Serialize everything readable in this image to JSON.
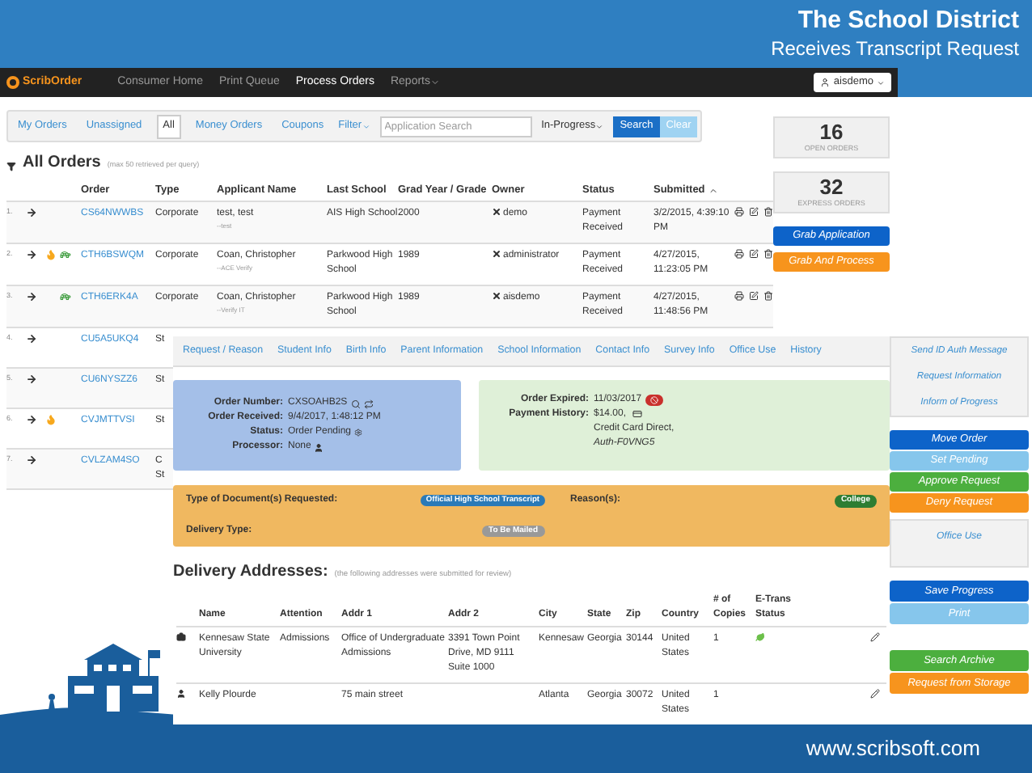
{
  "slide": {
    "title": "The School District",
    "subtitle": "Receives Transcript Request",
    "website": "www.scribsoft.com"
  },
  "navbar": {
    "logo": "ScribOrder",
    "items": [
      {
        "label": "Consumer Home",
        "selected": false,
        "dropdown": false
      },
      {
        "label": "Print Queue",
        "selected": false,
        "dropdown": false
      },
      {
        "label": "Process Orders",
        "selected": true,
        "dropdown": false
      },
      {
        "label": "Reports",
        "selected": false,
        "dropdown": true
      }
    ],
    "user": "aisdemo"
  },
  "filter_tabs": [
    {
      "label": "My Orders",
      "selected": false
    },
    {
      "label": "Unassigned",
      "selected": false
    },
    {
      "label": "All",
      "selected": true
    },
    {
      "label": "Money Orders",
      "selected": false
    },
    {
      "label": "Coupons",
      "selected": false
    }
  ],
  "filter_menu": "Filter",
  "search": {
    "placeholder": "Application Search"
  },
  "status_select": "In-Progress",
  "search_button": "Search",
  "clear_button": "Clear",
  "counters": [
    {
      "value": "16",
      "label": "OPEN ORDERS"
    },
    {
      "value": "32",
      "label": "EXPRESS ORDERS"
    }
  ],
  "grab_buttons": [
    {
      "label": "Grab Application",
      "kind": "primary"
    },
    {
      "label": "Grab And Process",
      "kind": "warning"
    }
  ],
  "orders": {
    "title": "All Orders",
    "note": "(max 50 retrieved per query)",
    "columns": [
      "Order",
      "Type",
      "Applicant Name",
      "Last School",
      "Grad Year / Grade",
      "Owner",
      "Status",
      "Submitted"
    ],
    "rows": [
      {
        "number": "1.",
        "alert": false,
        "express": false,
        "order": "CS64NWWBS",
        "type": "Corporate",
        "applicant": "test, test",
        "applicant_note": "--test",
        "school": "AIS High School",
        "grad": "2000",
        "owner": "demo",
        "status": "Payment Received",
        "submitted": "3/2/2015, 4:39:10 PM"
      },
      {
        "number": "2.",
        "alert": true,
        "express": true,
        "order": "CTH6BSWQM",
        "type": "Corporate",
        "applicant": "Coan, Christopher",
        "applicant_note": "--ACE Verify",
        "school": "Parkwood High School",
        "grad": "1989",
        "owner": "administrator",
        "status": "Payment Received",
        "submitted": "4/27/2015, 11:23:05 PM"
      },
      {
        "number": "3.",
        "alert": false,
        "express": true,
        "order": "CTH6ERK4A",
        "type": "Corporate",
        "applicant": "Coan, Christopher",
        "applicant_note": "--Verify IT",
        "school": "Parkwood High School",
        "grad": "1989",
        "owner": "aisdemo",
        "status": "Payment Received",
        "submitted": "4/27/2015, 11:48:56 PM"
      },
      {
        "number": "4.",
        "alert": false,
        "express": false,
        "order": "CU5A5UKQ4",
        "type": "St"
      },
      {
        "number": "5.",
        "alert": false,
        "express": false,
        "order": "CU6NYSZZ6",
        "type": "St"
      },
      {
        "number": "6.",
        "alert": true,
        "express": false,
        "order": "CVJMTTVSI",
        "type": "St"
      },
      {
        "number": "7.",
        "alert": false,
        "express": false,
        "order": "CVLZAM4SO",
        "type": "C St"
      }
    ]
  },
  "detail_tabs": [
    "Request / Reason",
    "Student Info",
    "Birth Info",
    "Parent Information",
    "School Information",
    "Contact Info",
    "Survey Info",
    "Office Use",
    "History"
  ],
  "order_info": [
    {
      "label": "Order Number:",
      "value": "CXSOAHB2S"
    },
    {
      "label": "Order Received:",
      "value": "9/4/2017, 1:48:12 PM"
    },
    {
      "label": "Status:",
      "value": "Order Pending"
    },
    {
      "label": "Processor:",
      "value": "None"
    }
  ],
  "payment": {
    "expired_label": "Order Expired:",
    "expired": "11/03/2017",
    "history_label": "Payment History:",
    "history": [
      "$14.00,",
      "Credit Card Direct,",
      "Auth-F0VNG5"
    ]
  },
  "documents": {
    "type_label": "Type of Document(s) Requested:",
    "type": "Official High School Transcript",
    "delivery_label": "Delivery Type:",
    "delivery": "To Be Mailed",
    "reasons_label": "Reason(s):",
    "reason": "College"
  },
  "delivery": {
    "title": "Delivery Addresses:",
    "note": "(the following addresses were submitted for review)",
    "columns": [
      "Name",
      "Attention",
      "Addr 1",
      "Addr 2",
      "City",
      "State",
      "Zip",
      "Country",
      "# of Copies",
      "E-Trans Status"
    ],
    "rows": [
      {
        "kind": "organization",
        "name": "Kennesaw State University",
        "attention": "Admissions",
        "addr1": "Office of Undergraduate Admissions",
        "addr2": "3391 Town Point Drive, MD 9111 Suite 1000",
        "city": "Kennesaw",
        "state": "Georgia",
        "zip": "30144",
        "country": "United States",
        "copies": "1",
        "etrans_sent": true
      },
      {
        "kind": "person",
        "name": "Kelly Plourde",
        "addr1": "75 main street",
        "city": "Atlanta",
        "state": "Georgia",
        "zip": "30072",
        "country": "United States",
        "copies": "1",
        "etrans_sent": false
      }
    ]
  },
  "side_links": [
    "Send ID Auth Message",
    "Request Information",
    "Inform of Progress"
  ],
  "action_buttons": [
    {
      "label": "Move Order",
      "kind": "primary"
    },
    {
      "label": "Set Pending",
      "kind": "info"
    },
    {
      "label": "Approve Request",
      "kind": "success"
    },
    {
      "label": "Deny Request",
      "kind": "warning"
    }
  ],
  "office_use": "Office Use",
  "save_buttons": [
    {
      "label": "Save Progress",
      "kind": "primary"
    },
    {
      "label": "Print",
      "kind": "info"
    }
  ],
  "archive_buttons": [
    {
      "label": "Search Archive",
      "kind": "success"
    },
    {
      "label": "Request from Storage",
      "kind": "warning"
    }
  ]
}
